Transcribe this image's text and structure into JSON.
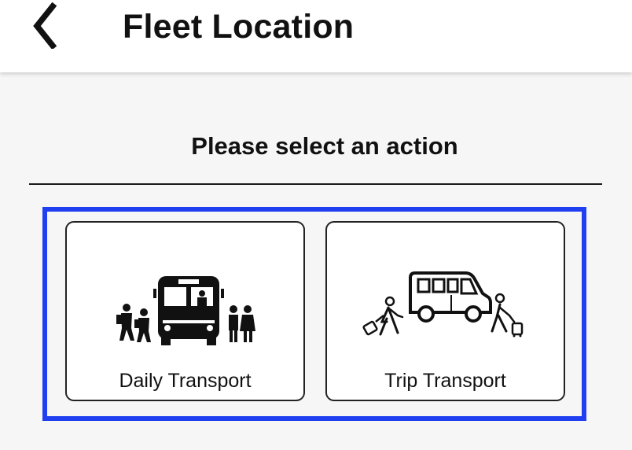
{
  "header": {
    "title": "Fleet Location",
    "back_icon": "chevron-left-icon"
  },
  "main": {
    "prompt": "Please select an action",
    "highlight_color": "#1f3ff0",
    "actions": [
      {
        "label": "Daily Transport",
        "icon": "school-bus-icon"
      },
      {
        "label": "Trip Transport",
        "icon": "travel-van-icon"
      }
    ]
  }
}
